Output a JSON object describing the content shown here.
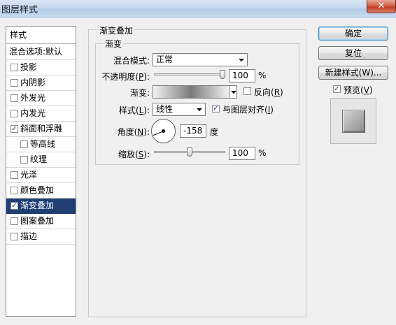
{
  "window": {
    "title": "图层样式",
    "close_glyph": "✕"
  },
  "styles_list": {
    "header": "样式",
    "blending_options": "混合选项:默认",
    "items": [
      {
        "label": "投影",
        "checked": false
      },
      {
        "label": "内阴影",
        "checked": false
      },
      {
        "label": "外发光",
        "checked": false
      },
      {
        "label": "内发光",
        "checked": false
      },
      {
        "label": "斜面和浮雕",
        "checked": true
      },
      {
        "label": "等高线",
        "checked": false
      },
      {
        "label": "纹理",
        "checked": false
      },
      {
        "label": "光泽",
        "checked": false
      },
      {
        "label": "颜色叠加",
        "checked": false
      },
      {
        "label": "渐变叠加",
        "checked": true,
        "selected": true
      },
      {
        "label": "图案叠加",
        "checked": false
      },
      {
        "label": "描边",
        "checked": false
      }
    ]
  },
  "gradient_overlay": {
    "group_title": "渐变叠加",
    "sub_title": "渐变",
    "blend_mode": {
      "label": "混合模式:",
      "value": "正常"
    },
    "opacity": {
      "label_main": "不透明度(",
      "label_key": "P",
      "label_end": "):",
      "value": "100",
      "unit": "%",
      "level": 1.0
    },
    "gradient": {
      "label_main": "渐变",
      "label_end": ":",
      "reverse_label_main": "反向(",
      "reverse_key": "R",
      "reverse_end": ")",
      "reverse_checked": false
    },
    "style": {
      "label_main": "样式(",
      "label_key": "L",
      "label_end": "):",
      "value": "线性",
      "align_label_main": "与图层对齐(",
      "align_key": "I",
      "align_end": ")",
      "align_checked": true
    },
    "angle": {
      "label_main": "角度(",
      "label_key": "N",
      "label_end": "):",
      "value": "-158",
      "unit": "度"
    },
    "scale": {
      "label_main": "缩放(",
      "label_key": "S",
      "label_end": "):",
      "value": "100",
      "unit": "%",
      "level": 0.5
    }
  },
  "buttons": {
    "ok": "确定",
    "reset": "复位",
    "new_style": "新建样式(W)...",
    "preview_label_main": "预览(",
    "preview_key": "V",
    "preview_end": ")",
    "preview_checked": true
  },
  "colors": {
    "selected_row": "#1f3f74",
    "titlebar": "#c6d9ef",
    "close": "#c03f24"
  }
}
